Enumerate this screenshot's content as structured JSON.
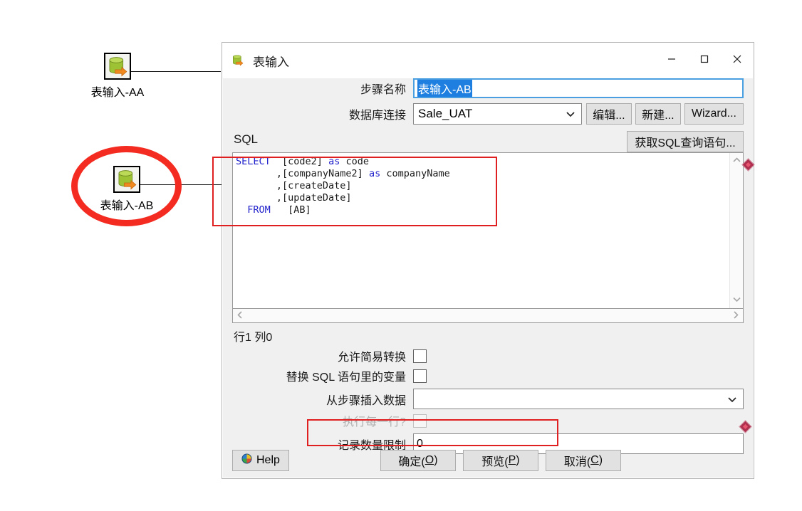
{
  "canvas": {
    "nodes": [
      {
        "label": "表输入-AA",
        "icon": "table-input-icon"
      },
      {
        "label": "表输入-AB",
        "icon": "table-input-icon"
      }
    ]
  },
  "dialog": {
    "title": "表输入",
    "title_icon": "table-input-icon",
    "window_controls": {
      "minimize": "minimize-icon",
      "maximize": "maximize-icon",
      "close": "close-icon"
    },
    "step_name": {
      "label": "步骤名称",
      "value": "表输入-AB",
      "selected": true
    },
    "connection": {
      "label": "数据库连接",
      "value": "Sale_UAT",
      "dropdown_icon": "chevron-down-icon",
      "buttons": {
        "edit": "编辑...",
        "new": "新建...",
        "wizard": "Wizard..."
      }
    },
    "get_sql_button": "获取SQL查询语句...",
    "sql": {
      "caption": "SQL",
      "lines": [
        {
          "keyword": "SELECT",
          "rest": "  [code2] ",
          "kw2": "as",
          "tail": " code"
        },
        {
          "keyword": "",
          "rest": "      ,[companyName2] ",
          "kw2": "as",
          "tail": " companyName"
        },
        {
          "keyword": "",
          "rest": "      ,[createDate]",
          "kw2": "",
          "tail": ""
        },
        {
          "keyword": "",
          "rest": "      ,[updateDate]",
          "kw2": "",
          "tail": ""
        },
        {
          "keyword": "  FROM",
          "rest": "   [AB]",
          "kw2": "",
          "tail": ""
        }
      ],
      "scroll_up_icon": "chevron-up-icon",
      "scroll_down_icon": "chevron-down-icon",
      "scroll_left_icon": "chevron-left-icon",
      "scroll_right_icon": "chevron-right-icon"
    },
    "cursor_status": "行1 列0",
    "options": {
      "allow_lazy_conversion": {
        "label": "允许简易转换",
        "checked": false
      },
      "replace_variables": {
        "label": "替换 SQL 语句里的变量",
        "checked": false
      },
      "insert_data_from_step": {
        "label": "从步骤插入数据",
        "value": "",
        "dropdown_icon": "chevron-down-icon"
      },
      "execute_for_each_row": {
        "label": "执行每一行?",
        "checked": false,
        "disabled": true
      },
      "limit_size": {
        "label": "记录数量限制",
        "value": "0"
      }
    },
    "footer": {
      "help": "Help",
      "help_icon": "help-globe-icon",
      "ok": "确定(O)",
      "ok_mnemonic": "O",
      "preview": "预览(P)",
      "preview_mnemonic": "P",
      "cancel": "取消(C)",
      "cancel_mnemonic": "C"
    }
  },
  "annotations": {
    "accent_red": "#e02020",
    "ellipse_red": "#f42b20",
    "marker_color": "#b03050"
  }
}
